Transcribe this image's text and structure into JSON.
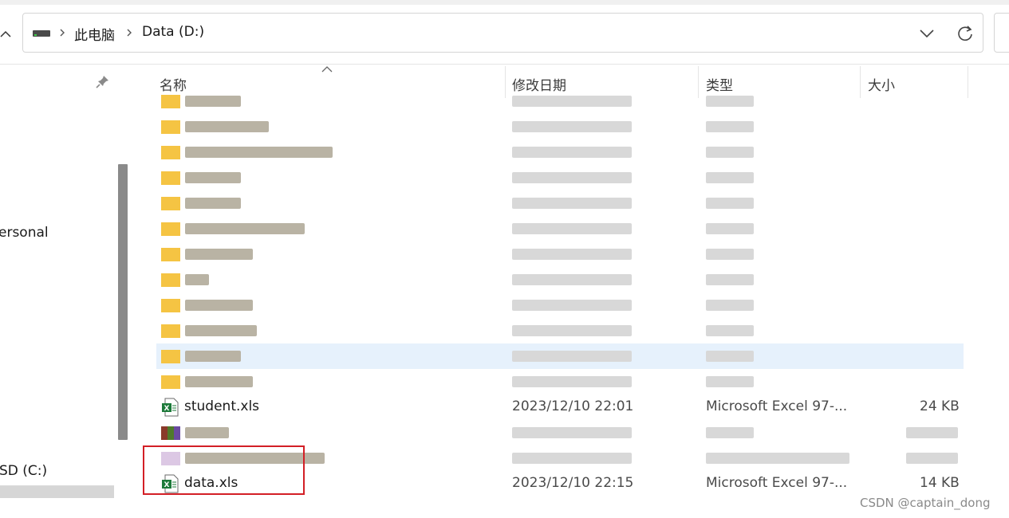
{
  "address_bar": {
    "breadcrumbs": [
      "此电脑",
      "Data (D:)"
    ],
    "drive_icon": "drive-icon",
    "dropdown_icon": "chevron-down-icon",
    "refresh_icon": "refresh-icon"
  },
  "nav_pane": {
    "items": [
      {
        "label": "ersonal"
      },
      {
        "label": "SD (C:)"
      }
    ],
    "pin_icon": "pin-icon"
  },
  "columns": {
    "name": "名称",
    "date": "修改日期",
    "type": "类型",
    "size": "大小"
  },
  "files": [
    {
      "name": "student.xls",
      "date": "2023/12/10 22:01",
      "type": "Microsoft Excel 97-...",
      "size": "24 KB",
      "icon": "excel-file-icon"
    },
    {
      "name": "data.xls",
      "date": "2023/12/10 22:15",
      "type": "Microsoft Excel 97-...",
      "size": "14 KB",
      "icon": "excel-file-icon"
    }
  ],
  "watermark": "CSDN @captain_dong",
  "colors": {
    "highlight_row": "#e6f1fc",
    "annotation_box": "#d31f26",
    "folder": "#f5c443"
  }
}
